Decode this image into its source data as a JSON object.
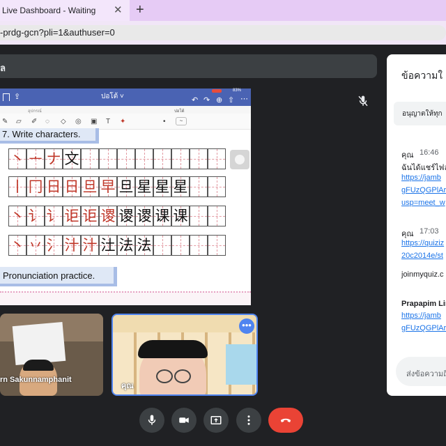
{
  "browser": {
    "tab_title": "Live Dashboard - Waiting",
    "tab_close": "✕",
    "new_tab": "+",
    "url": "-prdg-gcn?pli=1&authuser=0"
  },
  "meet": {
    "title_fragment": "ล",
    "mic_muted_icon": "mic-off"
  },
  "presentation": {
    "app_title": "ปอโต้ ˅",
    "tab_left": "อุปกรณ์",
    "tab_right": "ปอโต้",
    "battery": "83%",
    "heading_1": "7. Write characters.",
    "heading_2": "Pronunciation practice.",
    "rows": [
      [
        "丶",
        "ᅩ",
        "ナ",
        "文"
      ],
      [
        "丨",
        "冂",
        "日",
        "日",
        "旦",
        "早",
        "旦",
        "星",
        "星",
        "星"
      ],
      [
        "丶",
        "讠",
        "讠",
        "讵",
        "讵",
        "谡",
        "谡",
        "谡",
        "课",
        "课"
      ],
      [
        "丶",
        "丷",
        "氵",
        "汁",
        "汁",
        "汢",
        "法",
        "法"
      ]
    ]
  },
  "tiles": [
    {
      "name": "rn Sakunnamphanit"
    },
    {
      "name": "คุณ"
    }
  ],
  "chat": {
    "title": "ข้อความใ",
    "setting": "อนุญาตให้ทุก",
    "messages": [
      {
        "sender": "คุณ",
        "time": "16:46",
        "text": "ฉันได้แชร์ไฟล",
        "links": [
          "https://jamb",
          "gFUzQGPlAr",
          "usp=meet_w"
        ]
      },
      {
        "sender": "คุณ",
        "time": "17:03",
        "links": [
          "https://quiziz",
          "20c2014e/st"
        ],
        "text": "joinmyquiz.c"
      },
      {
        "sender": "Prapapim Lin",
        "links": [
          "https://jamb",
          "gFUzQGPlAr"
        ]
      }
    ],
    "input_placeholder": "ส่งข้อความถึ"
  }
}
